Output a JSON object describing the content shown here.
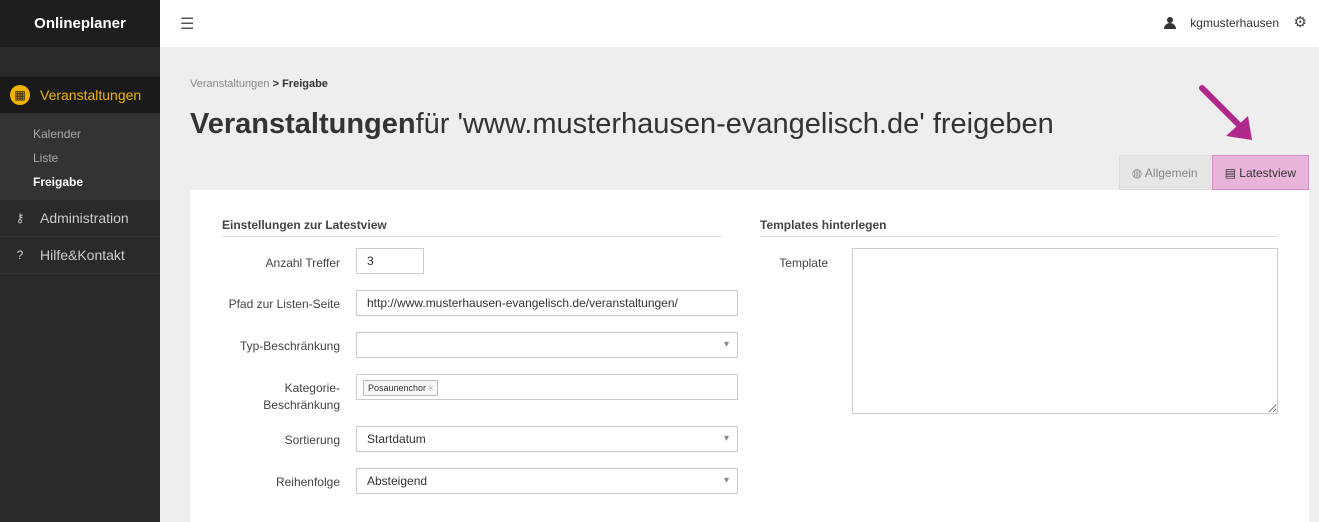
{
  "sidebar": {
    "brand": "Onlineplaner",
    "items": [
      {
        "label": "Veranstaltungen",
        "icon": "calendar-icon",
        "active": true
      },
      {
        "label": "Administration",
        "icon": "key-icon",
        "active": false
      },
      {
        "label": "Hilfe&Kontakt",
        "icon": "question-icon",
        "active": false
      }
    ],
    "subitems": [
      {
        "label": "Kalender"
      },
      {
        "label": "Liste"
      },
      {
        "label": "Freigabe"
      }
    ],
    "accent": "#f0b400"
  },
  "topbar": {
    "menu_icon": "hamburger-icon",
    "username": "kgmusterhausen",
    "user_icon": "user-icon",
    "settings_icon": "gear-icon"
  },
  "breadcrumb": {
    "parent": "Veranstaltungen",
    "separator": ">",
    "current": "Freigabe"
  },
  "page": {
    "title_strong": "Veranstaltungen",
    "title_rest": "für 'www.musterhausen-evangelisch.de' freigeben"
  },
  "tabs": [
    {
      "label": "Allgemein",
      "icon": "globe-icon",
      "active": false
    },
    {
      "label": "Latestview",
      "icon": "newspaper-icon",
      "active": true
    }
  ],
  "form": {
    "left_heading": "Einstellungen zur Latestview",
    "right_heading": "Templates hinterlegen",
    "anzahl_label": "Anzahl Treffer",
    "anzahl_value": "3",
    "pfad_label": "Pfad zur Listen-Seite",
    "pfad_value": "http://www.musterhausen-evangelisch.de/veranstaltungen/",
    "typ_label": "Typ-Beschränkung",
    "typ_value": "",
    "kategorie_label_1": "Kategorie-",
    "kategorie_label_2": "Beschränkung",
    "kategorie_tag": "Posaunenchor",
    "kategorie_tag_remove": "×",
    "sortierung_label": "Sortierung",
    "sortierung_value": "Startdatum",
    "reihenfolge_label": "Reihenfolge",
    "reihenfolge_value": "Absteigend",
    "template_label": "Template",
    "template_value": ""
  },
  "annotation": {
    "arrow_color": "#b0288c",
    "active_tab_color": "#e8b4d9"
  }
}
